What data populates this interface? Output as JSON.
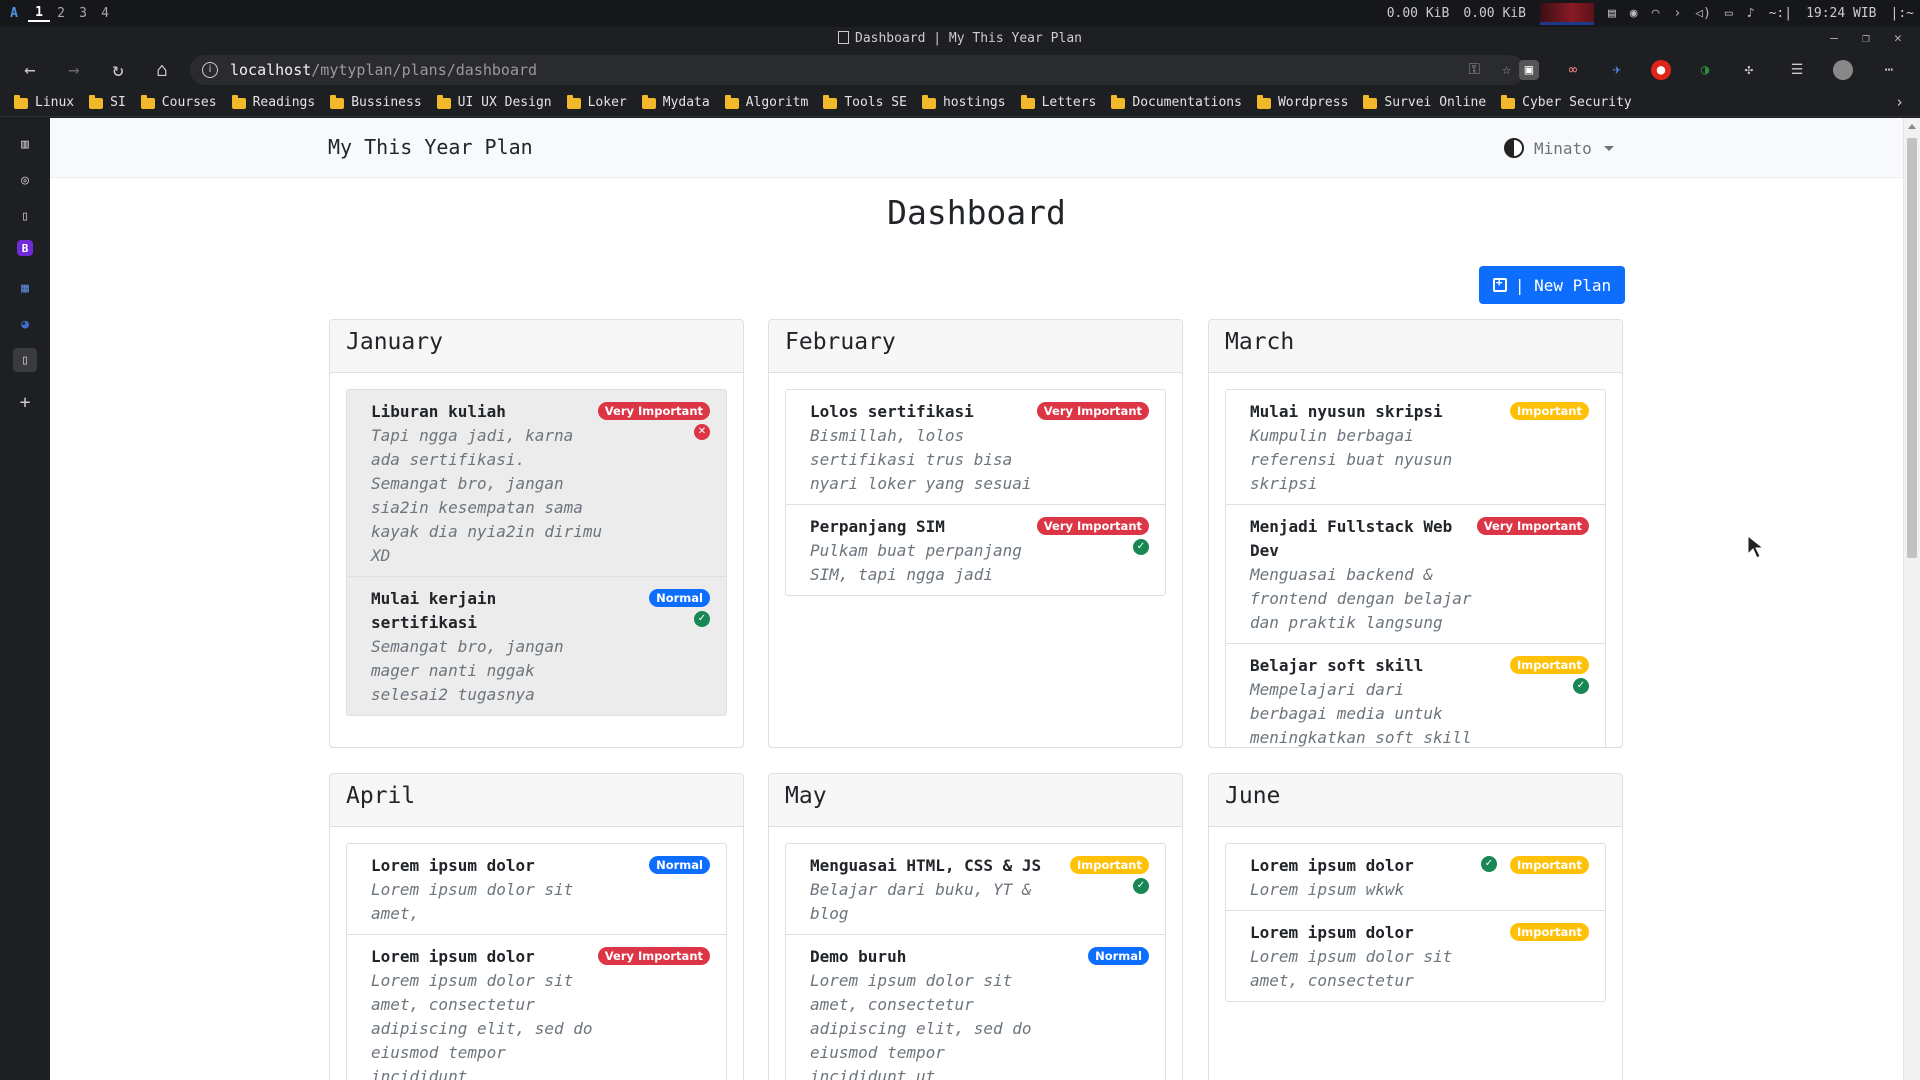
{
  "system_bar": {
    "logo": "A",
    "workspaces": [
      "1",
      "2",
      "3",
      "4"
    ],
    "net_down": "0.00 KiB",
    "net_up": "0.00 KiB",
    "clock": "19:24 WIB",
    "extra": "~:|",
    "tail": "|:~"
  },
  "window": {
    "title": "Dashboard | My This Year Plan"
  },
  "browser": {
    "url_host": "localhost",
    "url_path": "/mytyplan/plans/dashboard",
    "bookmarks": [
      "Linux",
      "SI",
      "Courses",
      "Readings",
      "Bussiness",
      "UI UX Design",
      "Loker",
      "Mydata",
      "Algoritm",
      "Tools SE",
      "hostings",
      "Letters",
      "Documentations",
      "Wordpress",
      "Survei Online",
      "Cyber Security"
    ]
  },
  "app": {
    "brand": "My This Year Plan",
    "user": "Minato",
    "page_title": "Dashboard",
    "new_plan_label": "| New Plan"
  },
  "months": [
    {
      "name": "January",
      "plans": [
        {
          "title": "Liburan kuliah",
          "desc": "Tapi ngga jadi, karna ada sertifikasi. Semangat bro, jangan sia2in kesempatan sama kayak dia nyia2in dirimu XD",
          "priority": "Very Important",
          "status": "failed"
        },
        {
          "title": "Mulai kerjain sertifikasi",
          "desc": "Semangat bro, jangan mager nanti nggak selesai2 tugasnya",
          "priority": "Normal",
          "status": "done"
        }
      ]
    },
    {
      "name": "February",
      "plans": [
        {
          "title": "Lolos sertifikasi",
          "desc": "Bismillah, lolos sertifikasi trus bisa nyari loker yang sesuai",
          "priority": "Very Important",
          "status": ""
        },
        {
          "title": "Perpanjang SIM",
          "desc": "Pulkam buat perpanjang SIM, tapi ngga jadi",
          "priority": "Very Important",
          "status": "done"
        }
      ]
    },
    {
      "name": "March",
      "plans": [
        {
          "title": "Mulai nyusun skripsi",
          "desc": "Kumpulin berbagai referensi buat nyusun skripsi",
          "priority": "Important",
          "status": ""
        },
        {
          "title": "Menjadi Fullstack Web Dev",
          "desc": "Menguasai backend & frontend dengan belajar dan praktik langsung",
          "priority": "Very Important",
          "status": ""
        },
        {
          "title": "Belajar soft skill",
          "desc": "Mempelajari dari berbagai media untuk meningkatkan soft skill",
          "priority": "Important",
          "status": "done"
        }
      ]
    },
    {
      "name": "April",
      "plans": [
        {
          "title": "Lorem ipsum dolor",
          "desc": "Lorem ipsum dolor sit amet,",
          "priority": "Normal",
          "status": ""
        },
        {
          "title": "Lorem ipsum dolor",
          "desc": "Lorem ipsum dolor sit amet, consectetur adipiscing elit, sed do eiusmod tempor incididunt",
          "priority": "Very Important",
          "status": ""
        }
      ]
    },
    {
      "name": "May",
      "plans": [
        {
          "title": "Menguasai HTML, CSS & JS",
          "desc": "Belajar dari buku, YT & blog",
          "priority": "Important",
          "status": "done"
        },
        {
          "title": "Demo buruh",
          "desc": "Lorem ipsum dolor sit amet, consectetur adipiscing elit, sed do eiusmod tempor incididunt ut",
          "priority": "Normal",
          "status": ""
        }
      ]
    },
    {
      "name": "June",
      "plans": [
        {
          "title": "Lorem ipsum dolor",
          "desc": "Lorem ipsum wkwk",
          "priority": "Important",
          "status": "done-inline"
        },
        {
          "title": "Lorem ipsum dolor",
          "desc": "Lorem ipsum dolor sit amet, consectetur",
          "priority": "Important",
          "status": ""
        }
      ]
    }
  ],
  "colors": {
    "very_important": "#dc3545",
    "important": "#ffc107",
    "normal": "#0d6efd",
    "done": "#198754",
    "primary_button": "#0d6efd"
  }
}
